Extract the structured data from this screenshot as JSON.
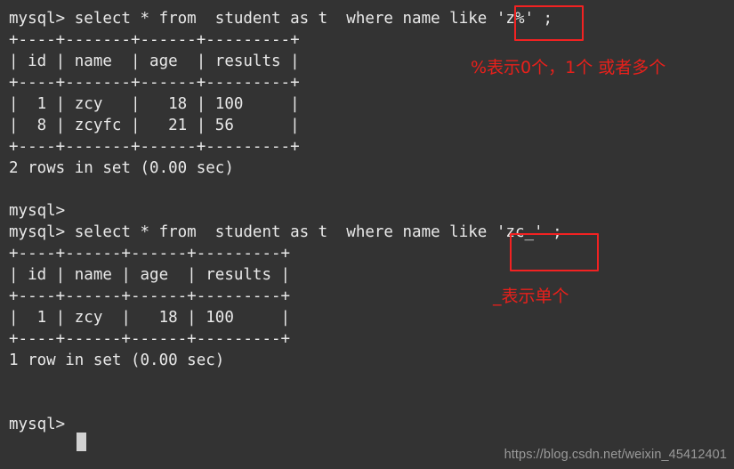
{
  "terminal": {
    "background_color": "#333333",
    "text_color": "#e9e9e9",
    "accent_color": "#f22222",
    "annotation_color": "#e8201b",
    "watermark_color": "#9a9a9a",
    "prompt": "mysql>",
    "lines": [
      "mysql> select * from  student as t  where name like 'z%' ;",
      "+----+-------+------+---------+",
      "| id | name  | age  | results |",
      "+----+-------+------+---------+",
      "|  1 | zcy   |   18 | 100     |",
      "|  8 | zcyfc |   21 | 56      |",
      "+----+-------+------+---------+",
      "2 rows in set (0.00 sec)",
      "",
      "mysql>",
      "mysql> select * from  student as t  where name like 'zc_' ;",
      "+----+------+------+---------+",
      "| id | name | age  | results |",
      "+----+------+------+---------+",
      "|  1 | zcy  |   18 | 100     |",
      "+----+------+------+---------+",
      "1 row in set (0.00 sec)",
      "",
      "",
      "mysql> "
    ]
  },
  "queries": [
    {
      "command": "select * from  student as t  where name like 'z%' ;",
      "pattern": "'z%'",
      "columns": [
        "id",
        "name",
        "age",
        "results"
      ],
      "rows": [
        [
          "1",
          "zcy",
          "18",
          "100"
        ],
        [
          "8",
          "zcyfc",
          "21",
          "56"
        ]
      ],
      "result_summary": "2 rows in set (0.00 sec)"
    },
    {
      "command": "select * from  student as t  where name like 'zc_' ;",
      "pattern": "'zc_'",
      "columns": [
        "id",
        "name",
        "age",
        "results"
      ],
      "rows": [
        [
          "1",
          "zcy",
          "18",
          "100"
        ]
      ],
      "result_summary": "1 row in set (0.00 sec)"
    }
  ],
  "annotations": [
    {
      "id": "percent",
      "text": "%表示0个，1个 或者多个"
    },
    {
      "id": "underscore",
      "text": "_表示单个"
    }
  ],
  "watermark": {
    "text": "https://blog.csdn.net/weixin_45412401"
  }
}
